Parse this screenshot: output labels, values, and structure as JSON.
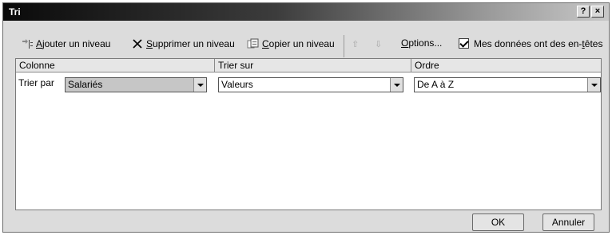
{
  "window": {
    "title": "Tri",
    "help_label": "?",
    "close_label": "×"
  },
  "toolbar": {
    "add_level": {
      "u": "A",
      "rest": "jouter un niveau"
    },
    "delete_level": {
      "u": "S",
      "rest": "upprimer un niveau"
    },
    "copy_level": {
      "u": "C",
      "rest": "opier un niveau"
    },
    "move_up_symbol": "⇧",
    "move_down_symbol": "⇩",
    "options": {
      "u": "O",
      "rest": "ptions..."
    },
    "headers_checkbox": {
      "before": "Mes données ont des en-",
      "u": "t",
      "after": "êtes",
      "checked": true
    }
  },
  "grid": {
    "columns": [
      "Colonne",
      "Trier sur",
      "Ordre"
    ],
    "rows": [
      {
        "label": "Trier par",
        "column": "Salariés",
        "sort_on": "Valeurs",
        "order": "De A à Z"
      }
    ]
  },
  "buttons": {
    "ok": "OK",
    "cancel": "Annuler"
  }
}
